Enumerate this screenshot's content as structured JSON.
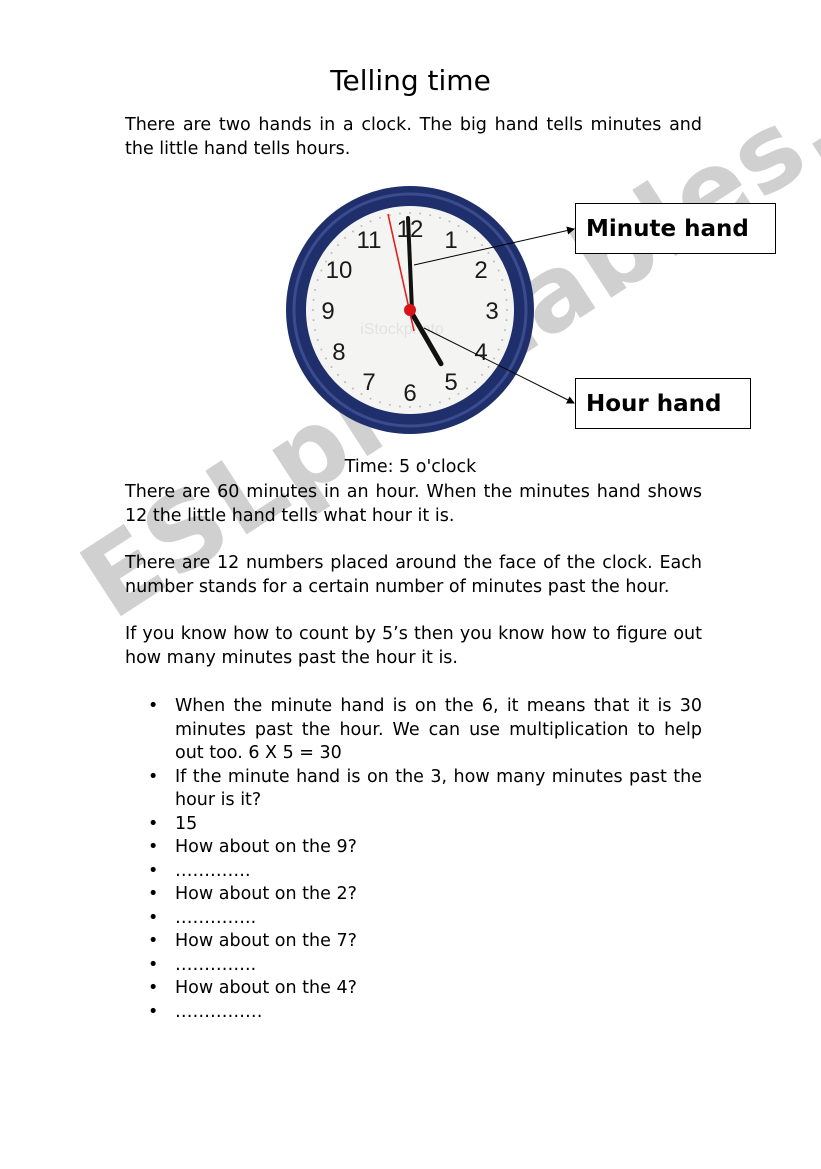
{
  "watermark": "ESLprintables.com",
  "title": "Telling time",
  "intro": "There are two hands in a clock. The big hand tells minutes and the little hand tells hours.",
  "clock": {
    "numbers": [
      "12",
      "1",
      "2",
      "3",
      "4",
      "5",
      "6",
      "7",
      "8",
      "9",
      "10",
      "11"
    ],
    "hour": 5,
    "minute": 0,
    "frame_color": "#1f2f6b",
    "second_hand_color": "#e0201a",
    "photo_watermark": "iStockphoto"
  },
  "labels": {
    "minute_hand": "Minute hand",
    "hour_hand": "Hour hand"
  },
  "caption": "Time: 5 o'clock",
  "paragraphs": [
    "There are 60 minutes in an hour. When the minutes hand shows 12 the little hand tells what hour it is.",
    "There are 12 numbers placed around the face of the clock. Each number stands for a certain number of minutes past the hour.",
    "If you know how to count by 5’s then you know how to figure out how many minutes past the hour it is."
  ],
  "bullets": [
    " When the minute hand is on the 6, it means that it is 30 minutes past the hour.  We can use multiplication to help out too.  6 X 5 = 30",
    "If the minute hand is on the 3, how many minutes past the hour is it?",
    " 15",
    "How about on the 9?",
    " ………….",
    "How about on the 2?",
    " …………..",
    "How about on the 7?",
    " …………..",
    "How about on the 4?",
    " ……………"
  ]
}
